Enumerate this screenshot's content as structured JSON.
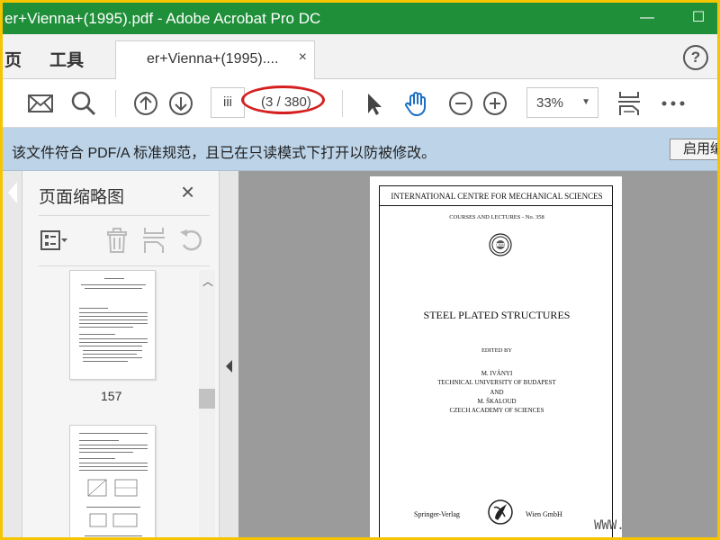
{
  "window": {
    "title": "er+Vienna+(1995).pdf - Adobe Acrobat Pro DC",
    "minimize_glyph": "—",
    "maximize_glyph": "☐",
    "accent_color": "#1f8f3a"
  },
  "tabbar": {
    "nav_home": "页",
    "nav_tools": "工具",
    "tab_label": "er+Vienna+(1995)....",
    "tab_close": "×",
    "help": "?"
  },
  "toolbar": {
    "page_input": "iii",
    "page_count": "(3 / 380)",
    "zoom": "33%",
    "icons": [
      "email-icon",
      "search-icon",
      "page-up-icon",
      "page-down-icon",
      "select-arrow-icon",
      "hand-icon",
      "zoom-out-icon",
      "zoom-in-icon",
      "fit-page-icon",
      "more-icon"
    ]
  },
  "infobar": {
    "message": "该文件符合 PDF/A 标准规范，且已在只读模式下打开以防被修改。",
    "enable_button": "启用编"
  },
  "thumbnail_panel": {
    "title": "页面缩略图",
    "close": "×",
    "thumbs": [
      {
        "page_label": "157"
      },
      {
        "page_label": ""
      }
    ]
  },
  "document": {
    "header": "INTERNATIONAL CENTRE FOR MECHANICAL SCIENCES",
    "series": "COURSES AND LECTURES - No. 358",
    "title": "STEEL PLATED STRUCTURES",
    "edited_by": "EDITED BY",
    "editor1": "M. IVÁNYI",
    "affil1": "TECHNICAL UNIVERSITY OF BUDAPEST",
    "and": "AND",
    "editor2": "M. ŠKALOUD",
    "affil2": "CZECH ACADEMY OF SCIENCES",
    "publisher_left": "Springer-Verlag",
    "publisher_right": "Wien GmbH"
  },
  "watermark": {
    "bottom": "WWW."
  }
}
